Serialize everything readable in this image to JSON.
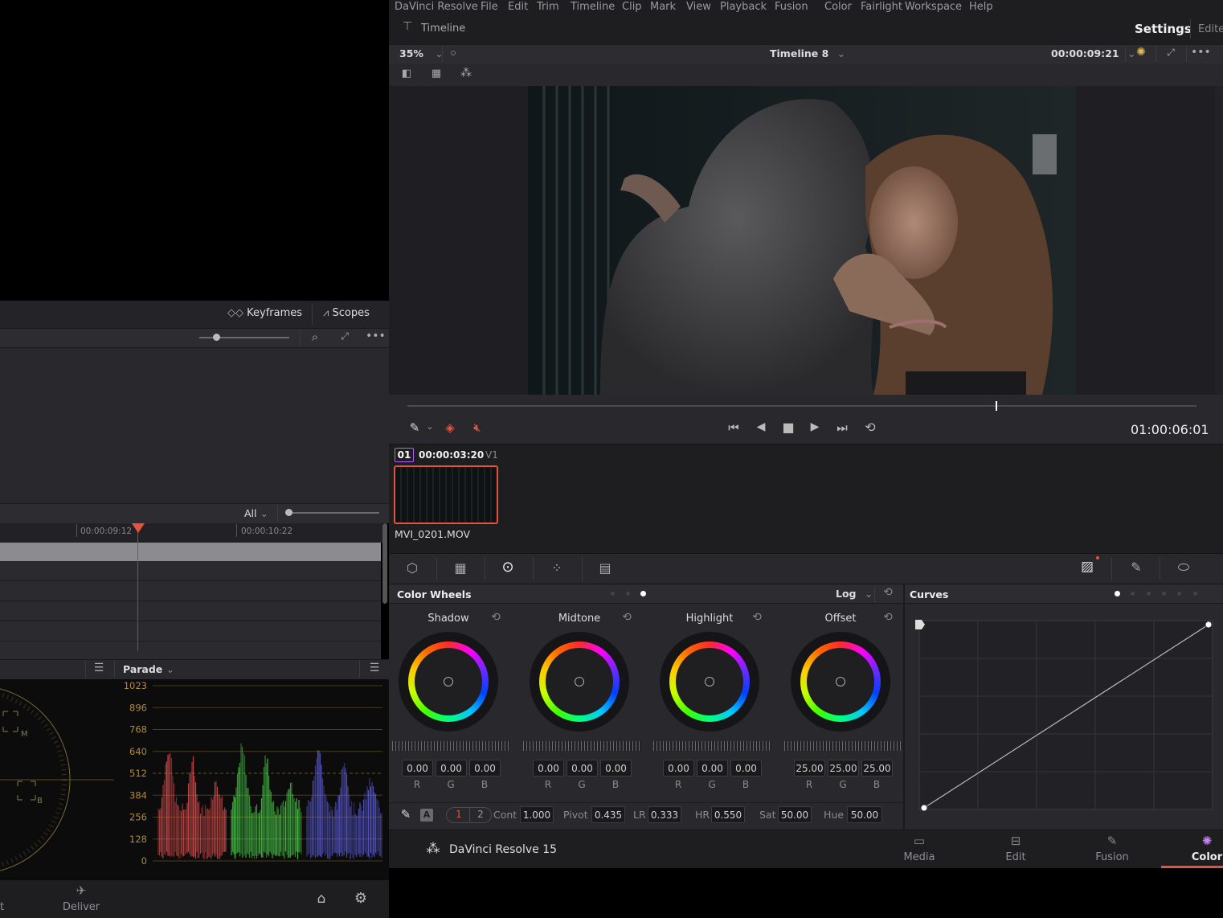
{
  "menu": [
    "DaVinci Resolve",
    "File",
    "Edit",
    "Trim",
    "Timeline",
    "Clip",
    "Mark",
    "View",
    "Playback",
    "Fusion",
    "Color",
    "Fairlight",
    "Workspace",
    "Help"
  ],
  "header": {
    "timeline_label": "Timeline",
    "settings": "Settings",
    "edit_partial": "Edite"
  },
  "viewer": {
    "zoom": "35%",
    "timeline_name": "Timeline 8",
    "timecode_top": "00:00:09:21",
    "timecode_main": "01:00:06:01",
    "scrub_position": 0.745
  },
  "left": {
    "keyframes": "Keyframes",
    "scopes": "Scopes",
    "all": "All",
    "tc1": "00:00:09:12",
    "tc2": "00:00:10:22",
    "parade": "Parade",
    "parade_ticks": [
      "1023",
      "896",
      "768",
      "640",
      "512",
      "384",
      "256",
      "128",
      "0"
    ],
    "vectorscope_labels": [
      "M",
      "B"
    ],
    "deliver": "Deliver",
    "partial": "t"
  },
  "clip": {
    "number": "01",
    "timecode": "00:00:03:20",
    "track": "V1",
    "name": "MVI_0201.MOV"
  },
  "wheels": {
    "title": "Color Wheels",
    "mode": "Log",
    "items": [
      {
        "name": "Shadow",
        "r": "0.00",
        "g": "0.00",
        "b": "0.00"
      },
      {
        "name": "Midtone",
        "r": "0.00",
        "g": "0.00",
        "b": "0.00"
      },
      {
        "name": "Highlight",
        "r": "0.00",
        "g": "0.00",
        "b": "0.00"
      },
      {
        "name": "Offset",
        "r": "25.00",
        "g": "25.00",
        "b": "25.00"
      }
    ],
    "rgb": [
      "R",
      "G",
      "B"
    ],
    "auto": "A",
    "page1": "1",
    "page2": "2",
    "params": [
      {
        "label": "Cont",
        "value": "1.000"
      },
      {
        "label": "Pivot",
        "value": "0.435"
      },
      {
        "label": "LR",
        "value": "0.333"
      },
      {
        "label": "HR",
        "value": "0.550"
      },
      {
        "label": "Sat",
        "value": "50.00"
      },
      {
        "label": "Hue",
        "value": "50.00"
      }
    ]
  },
  "curves": {
    "title": "Curves"
  },
  "footer": {
    "app": "DaVinci Resolve 15",
    "tabs": [
      "Media",
      "Edit",
      "Fusion",
      "Color"
    ]
  },
  "colors": {
    "accent": "#e5533d",
    "panel": "#28282e",
    "bg": "#1e1e21"
  }
}
